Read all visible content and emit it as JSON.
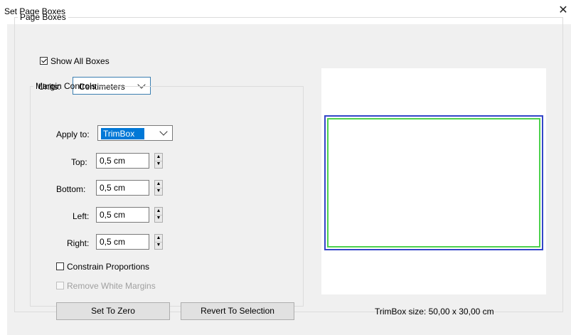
{
  "window": {
    "title": "Set Page Boxes",
    "close_glyph": "✕"
  },
  "page_boxes": {
    "group_label": "Page Boxes",
    "show_all_boxes": {
      "label": "Show All Boxes",
      "checked": true
    },
    "units": {
      "label": "Units:",
      "selected": "Centimeters"
    }
  },
  "margin_controls": {
    "group_label": "Margin Controls",
    "apply_to": {
      "label": "Apply to:",
      "selected": "TrimBox"
    },
    "top": {
      "label": "Top:",
      "value": "0,5 cm"
    },
    "bottom": {
      "label": "Bottom:",
      "value": "0,5 cm"
    },
    "left": {
      "label": "Left:",
      "value": "0,5 cm"
    },
    "right": {
      "label": "Right:",
      "value": "0,5 cm"
    },
    "constrain": {
      "label": "Constrain Proportions",
      "checked": false
    },
    "remove_white": {
      "label": "Remove White Margins",
      "checked": false,
      "disabled": true
    },
    "set_to_zero": "Set To Zero",
    "revert": "Revert To Selection"
  },
  "preview": {
    "size_text": "TrimBox size: 50,00 x 30,00 cm",
    "outer_color": "#3346c8",
    "inner_color": "#4dd14d"
  },
  "icons": {
    "spin_up": "▲",
    "spin_down": "▼",
    "close": "close-icon",
    "chevron": "chevron-down-icon"
  }
}
